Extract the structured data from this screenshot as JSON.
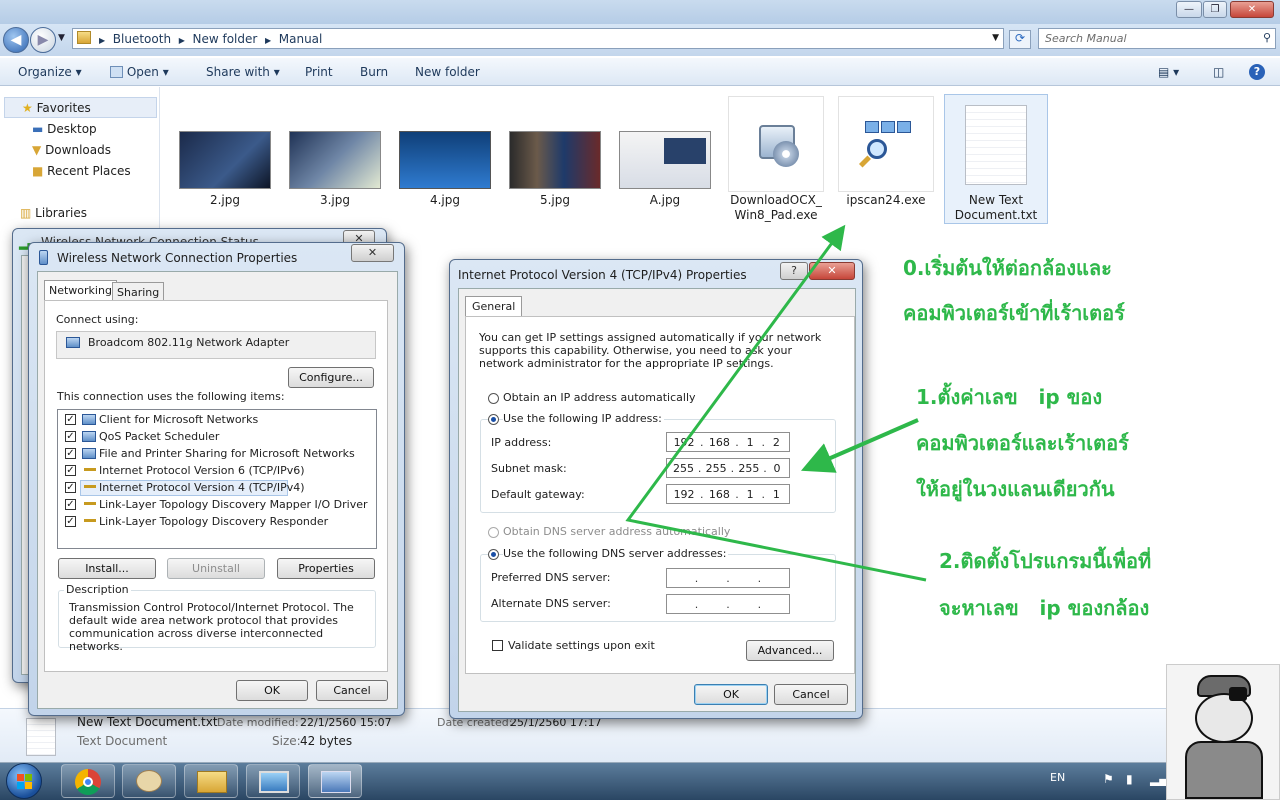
{
  "explorer": {
    "breadcrumb": [
      "Bluetooth",
      "New folder",
      "Manual"
    ],
    "search_placeholder": "Search Manual",
    "commands": [
      "Organize",
      "Open",
      "Share with",
      "Print",
      "Burn",
      "New folder"
    ],
    "nav": [
      "Favorites",
      "Desktop",
      "Downloads",
      "Recent Places",
      "Libraries"
    ],
    "files": [
      {
        "name": "2.jpg"
      },
      {
        "name": "3.jpg"
      },
      {
        "name": "4.jpg"
      },
      {
        "name": "5.jpg"
      },
      {
        "name": "A.jpg"
      },
      {
        "name": "DownloadOCX_\nWin8_Pad.exe"
      },
      {
        "name": "ipscan24.exe"
      },
      {
        "name": "New Text\nDocument.txt"
      }
    ],
    "details": {
      "name": "New Text Document.txt",
      "modified_label": "Date modified:",
      "modified_value": "22/1/2560 15:07",
      "created_label": "Date created:",
      "created_value": "25/1/2560 17:17",
      "type": "Text Document",
      "size_label": "Size:",
      "size_value": "42 bytes"
    }
  },
  "status_dialog": {
    "title": "Wireless Network Connection Status"
  },
  "props_dialog": {
    "title": "Wireless Network Connection Properties",
    "tabs": [
      "Networking",
      "Sharing"
    ],
    "connect_using_label": "Connect using:",
    "adapter": "Broadcom 802.11g Network Adapter",
    "configure_btn": "Configure...",
    "items_label": "This connection uses the following items:",
    "items": [
      "Client for Microsoft Networks",
      "QoS Packet Scheduler",
      "File and Printer Sharing for Microsoft Networks",
      "Internet Protocol Version 6 (TCP/IPv6)",
      "Internet Protocol Version 4 (TCP/IPv4)",
      "Link-Layer Topology Discovery Mapper I/O Driver",
      "Link-Layer Topology Discovery Responder"
    ],
    "install_btn": "Install...",
    "uninstall_btn": "Uninstall",
    "properties_btn": "Properties",
    "description_label": "Description",
    "description": "Transmission Control Protocol/Internet Protocol. The default wide area network protocol that provides communication across diverse interconnected networks.",
    "ok": "OK",
    "cancel": "Cancel"
  },
  "ipv4_dialog": {
    "title": "Internet Protocol Version 4 (TCP/IPv4) Properties",
    "help": "?",
    "tab": "General",
    "intro": "You can get IP settings assigned automatically if your network supports this capability. Otherwise, you need to ask your network administrator for the appropriate IP settings.",
    "auto_ip": "Obtain an IP address automatically",
    "manual_ip": "Use the following IP address:",
    "ip_label": "IP address:",
    "ip": [
      "192",
      "168",
      "1",
      "2"
    ],
    "mask_label": "Subnet mask:",
    "mask": [
      "255",
      "255",
      "255",
      "0"
    ],
    "gw_label": "Default gateway:",
    "gw": [
      "192",
      "168",
      "1",
      "1"
    ],
    "auto_dns": "Obtain DNS server address automatically",
    "manual_dns": "Use the following DNS server addresses:",
    "pdns_label": "Preferred DNS server:",
    "adns_label": "Alternate DNS server:",
    "validate": "Validate settings upon exit",
    "advanced": "Advanced...",
    "ok": "OK",
    "cancel": "Cancel"
  },
  "annotations": {
    "step0_line1": "0.เริ่มต้นให้ต่อกล้องและ",
    "step0_line2": "คอมพิวเตอร์เข้าที่เร้าเตอร์",
    "step1_line1": "1.ตั้งค่าเลข   ip ของ",
    "step1_line2": "คอมพิวเตอร์และเร้าเตอร์",
    "step1_line3": "ให้อยู่ในวงแลนเดียวกัน",
    "step2_line1": "2.ติดตั้งโปรแกรมนี้เพื่อที่",
    "step2_line2": "จะหาเลข   ip ของกล้อง",
    "color": "#2eb84a"
  },
  "tray": {
    "lang": "EN"
  }
}
